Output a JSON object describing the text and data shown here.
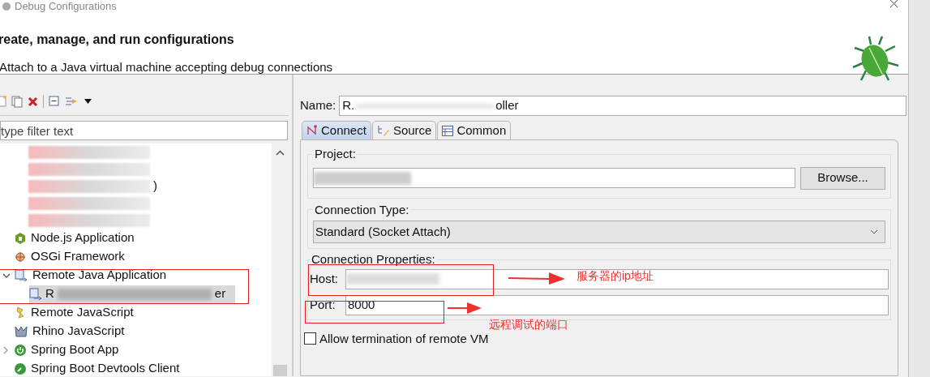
{
  "window": {
    "title": "Debug Configurations"
  },
  "header": {
    "title": "reate, manage, and run configurations",
    "message": "Attach to a Java virtual machine accepting debug connections"
  },
  "filter": {
    "placeholder": "type filter text"
  },
  "tree": [
    {
      "kind": "redacted"
    },
    {
      "kind": "redacted"
    },
    {
      "kind": "redacted",
      "label": ")"
    },
    {
      "kind": "redacted"
    },
    {
      "kind": "redacted"
    },
    {
      "kind": "node",
      "label": "Node.js Application",
      "expanded": false,
      "selected": false
    },
    {
      "kind": "osgi",
      "label": "OSGi Framework",
      "expanded": false,
      "selected": false
    },
    {
      "kind": "remote",
      "label": "Remote Java Application",
      "expanded": true,
      "selected": false,
      "children": [
        {
          "kind": "remote",
          "label": "R",
          "label_end": "er",
          "selected": true
        }
      ]
    },
    {
      "kind": "script",
      "label": "Remote JavaScript",
      "expanded": false,
      "selected": false
    },
    {
      "kind": "rhino",
      "label": "Rhino JavaScript",
      "expanded": false,
      "selected": false
    },
    {
      "kind": "spring",
      "label": "Spring Boot App",
      "expanded": false,
      "selected": false,
      "expandable": true
    },
    {
      "kind": "devtools",
      "label": "Spring Boot Devtools Client",
      "expanded": false,
      "selected": false
    }
  ],
  "name": {
    "label": "Name:",
    "value_start": "R.",
    "value_end": "oller"
  },
  "tabs": [
    {
      "label": "Connect",
      "selected": true
    },
    {
      "label": "Source",
      "selected": false
    },
    {
      "label": "Common",
      "selected": false
    }
  ],
  "project": {
    "label": "Project:",
    "button": "Browse..."
  },
  "connection_type": {
    "label": "Connection Type:",
    "value": "Standard (Socket Attach)"
  },
  "properties": {
    "label": "Connection Properties:",
    "host_label": "Host:",
    "port_label": "Port:",
    "port": "8000"
  },
  "allow_termination": {
    "label": "Allow termination of remote VM",
    "checked": false
  },
  "annotations": [
    {
      "text": "服务器的ip地址"
    },
    {
      "text": "远程调试的端口"
    }
  ]
}
